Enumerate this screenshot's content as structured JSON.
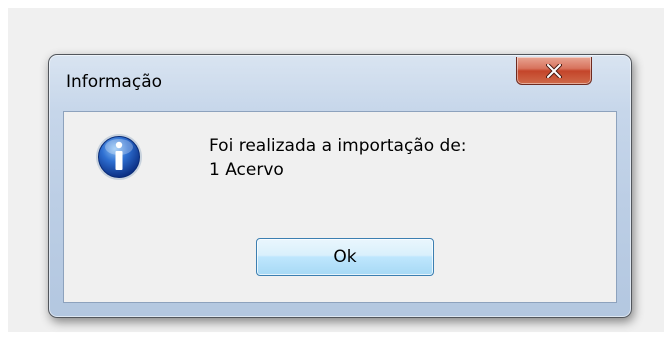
{
  "dialog": {
    "title": "Informação",
    "close_icon": "close-icon",
    "message_icon": "info-icon",
    "message_lines": [
      "Foi realizada a importação de:",
      "1 Acervo"
    ],
    "ok_label": "Ok"
  },
  "colors": {
    "frame": "#bccee5",
    "close_button": "#c4452a",
    "ok_button": "#bee6fd",
    "panel": "#f0f0f0"
  }
}
